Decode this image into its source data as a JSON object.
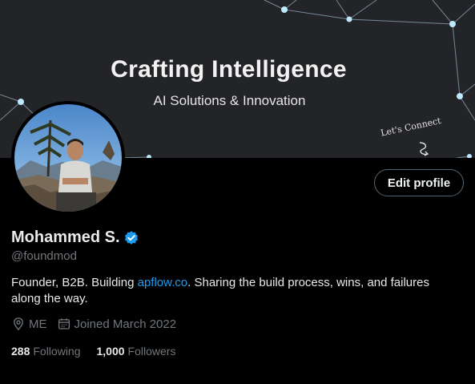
{
  "banner": {
    "title": "Crafting Intelligence",
    "subtitle": "AI Solutions & Innovation",
    "cta_text": "Let's Connect",
    "background_color": "#232427",
    "accent_color": "#8fd3f4"
  },
  "profile": {
    "name": "Mohammed S.",
    "handle": "@foundmod",
    "verified_icon": "verified-badge-icon",
    "bio_prefix": "Founder, B2B. Building ",
    "bio_link": "apflow.co",
    "bio_suffix": ". Sharing the build process, wins, and failures along the way.",
    "location": "ME",
    "joined": "Joined March 2022",
    "following_count": "288",
    "following_label": "Following",
    "followers_count": "1,000",
    "followers_label": "Followers"
  },
  "actions": {
    "edit_profile_label": "Edit profile"
  },
  "colors": {
    "link": "#1d9bf0",
    "secondary_text": "#71767b",
    "primary_text": "#e7e9ea"
  }
}
